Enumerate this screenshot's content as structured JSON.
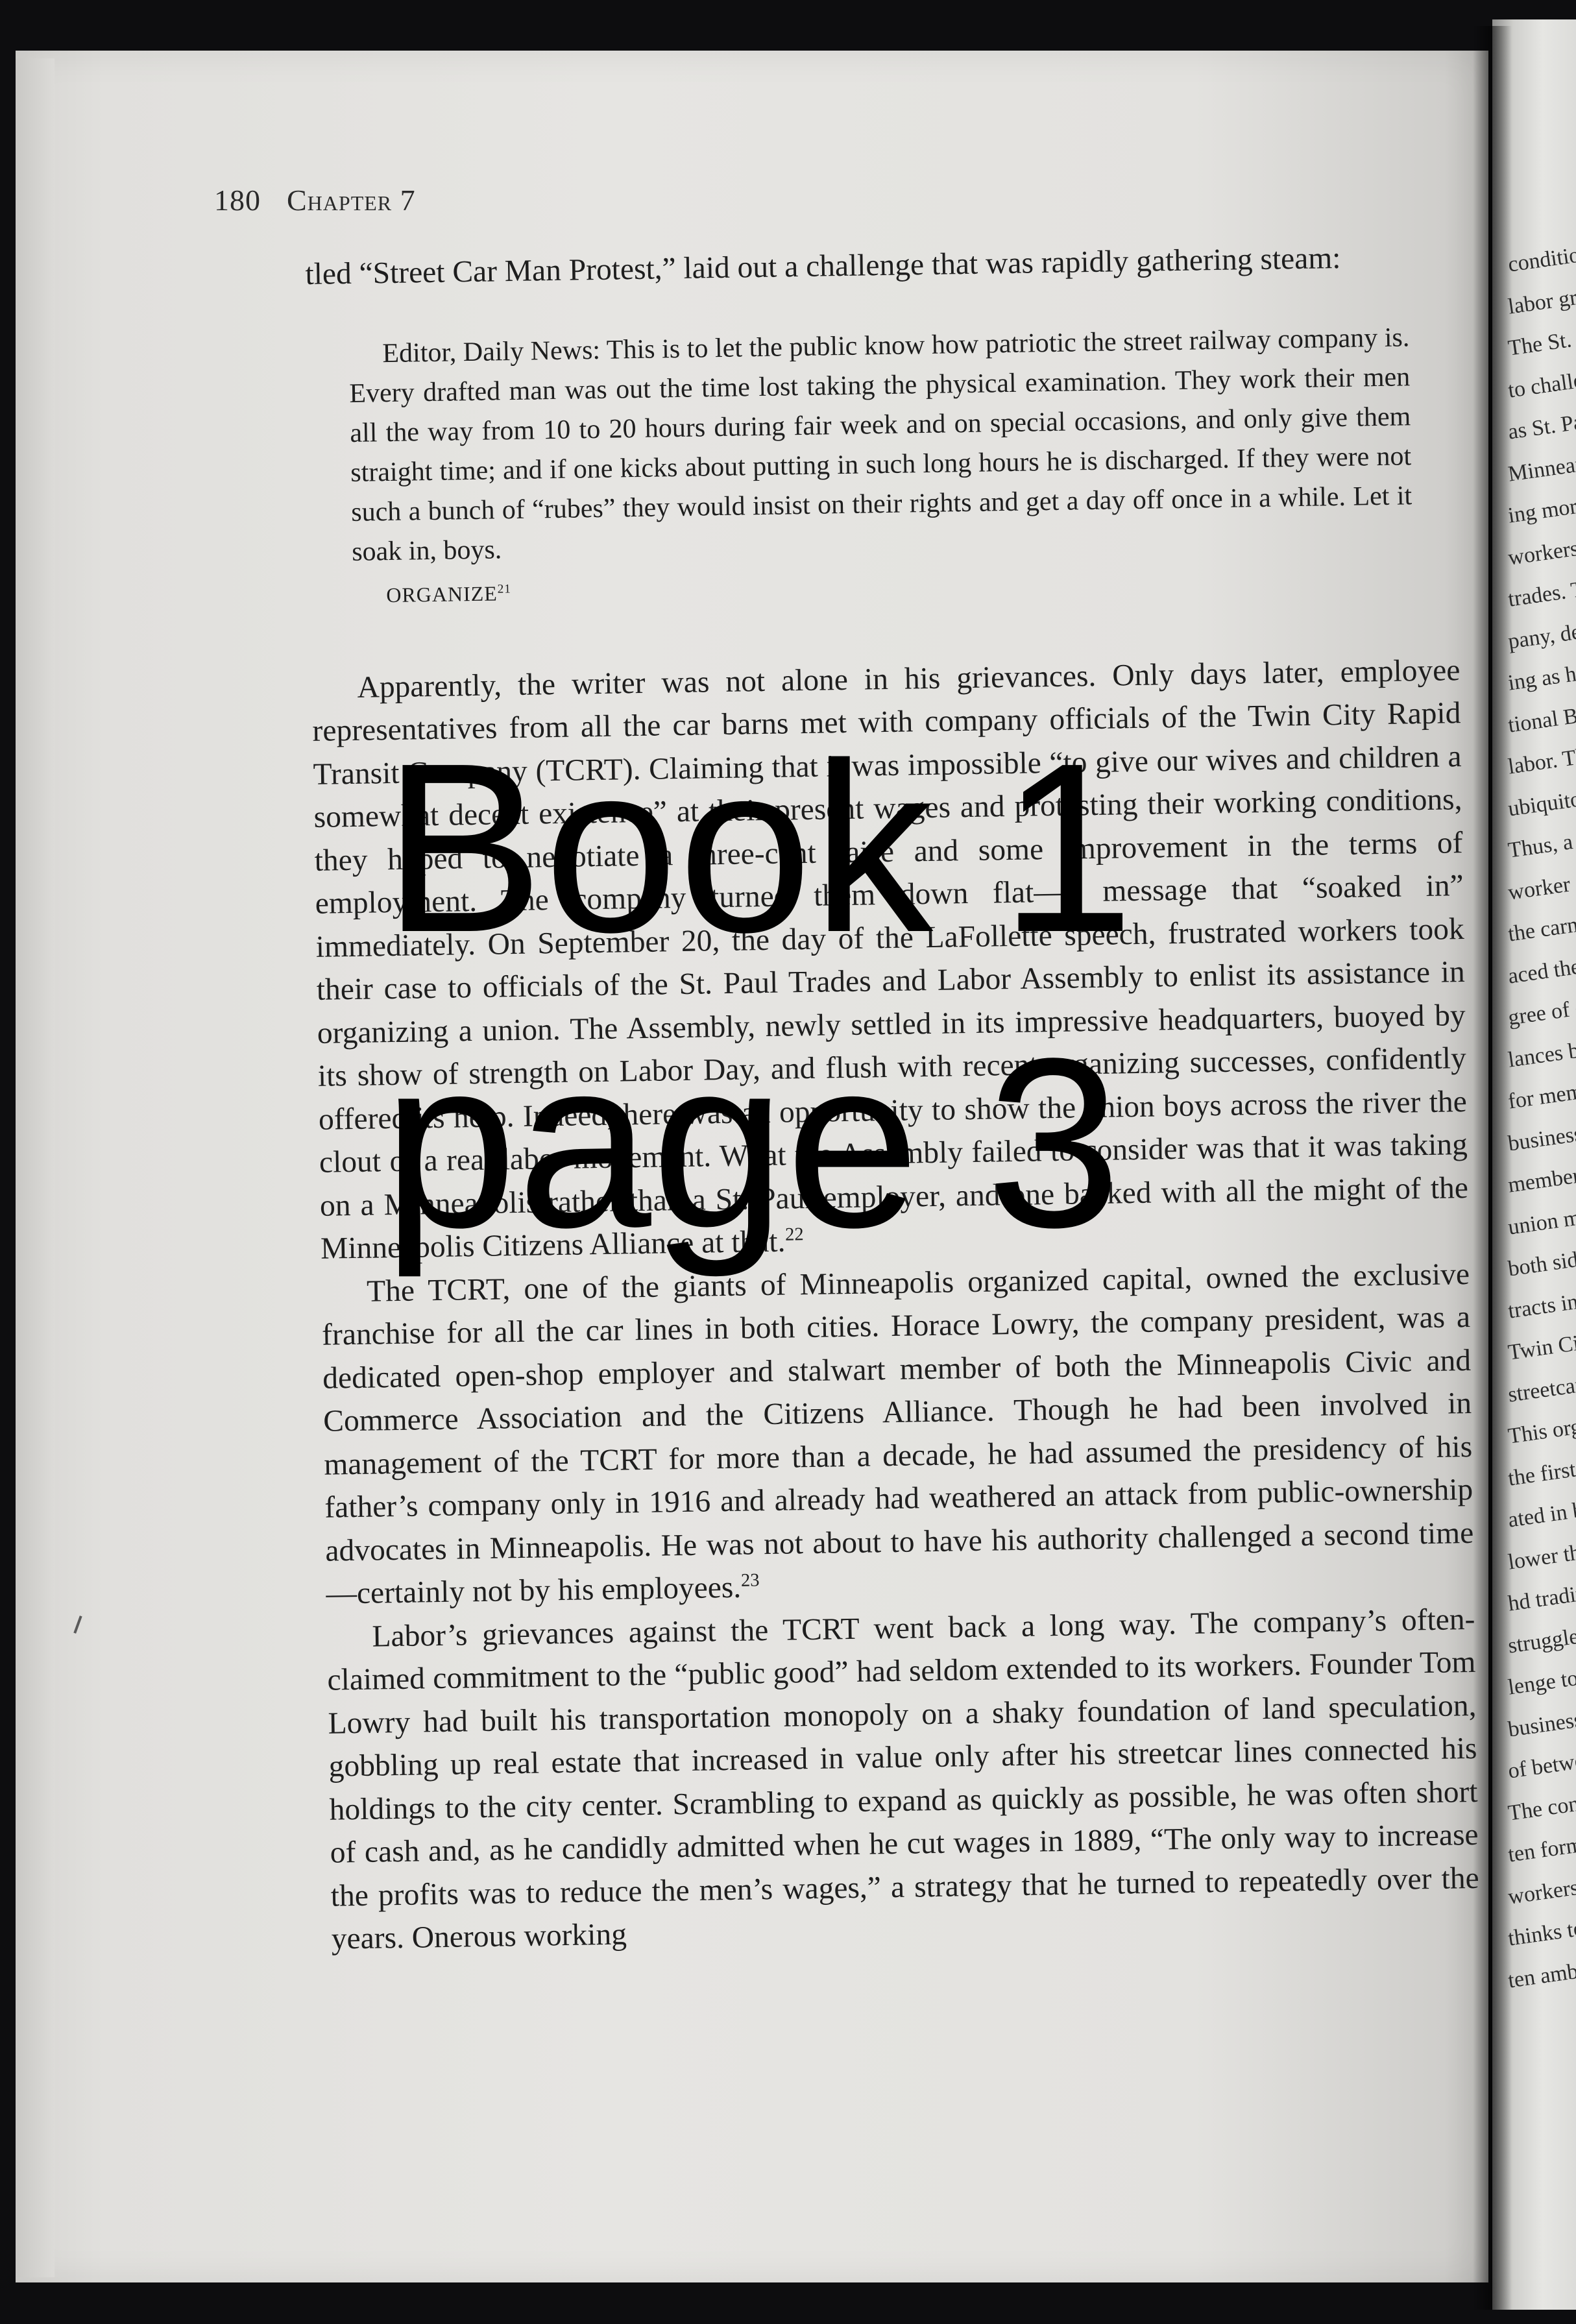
{
  "header": {
    "page_number": "180",
    "chapter": "Chapter 7"
  },
  "body": {
    "intro": "tled “Street Car Man Protest,” laid out a challenge that was rapidly gathering steam:",
    "extract": {
      "text": "Editor, Daily News: This is to let the public know how patriotic the street railway company is. Every drafted man was out the time lost taking the physical examination. They work their men all the way from 10 to 20 hours during fair week and on special occasions, and only give them straight time; and if one kicks about putting in such long hours he is discharged. If they were not such a bunch of “rubes” they would insist on their rights and get a day off once in a while. Let it soak in, boys.",
      "signature": "ORGANIZE",
      "note": "21"
    },
    "p1": {
      "text": "Apparently, the writer was not alone in his grievances. Only days later, employee representatives from all the car barns met with company officials of the Twin City Rapid Transit Company (TCRT). Claiming that it was impossible “to give our wives and children a somewhat decent existence” at their present wages and protesting their working conditions, they hoped to negotiate a three-cent raise and some improvement in the terms of employment. The company turned them down flat—a message that “soaked in” immediately. On September 20, the day of the LaFollette speech, frustrated workers took their case to officials of the St. Paul Trades and Labor Assembly to enlist its assistance in organizing a union. The Assembly, newly settled in its impressive headquarters, buoyed by its show of strength on Labor Day, and flush with recent organizing successes, confidently offered its help. Indeed, here was an opportunity to show the union boys across the river the clout of a real labor movement. What the Assembly failed to consider was that it was taking on a Minneapolis rather than a St. Paul employer, and one backed with all the might of the Minneapolis Citizens Alliance at that.",
      "note": "22"
    },
    "p2": {
      "text": "The TCRT, one of the giants of Minneapolis organized capital, owned the exclusive franchise for all the car lines in both cities. Horace Lowry, the company president, was a dedicated open-shop employer and stalwart member of both the Minneapolis Civic and Commerce Association and the Citizens Alliance. Though he had been involved in management of the TCRT for more than a decade, he had assumed the presidency of his father’s company only in 1916 and already had weathered an attack from public-ownership advocates in Minneapolis. He was not about to have his authority challenged a second time—certainly not by his employees.",
      "note": "23"
    },
    "p3": {
      "text": "Labor’s grievances against the TCRT went back a long way. The company’s often-claimed commitment to the “public good” had seldom extended to its workers. Founder Tom Lowry had built his transportation monopoly on a shaky foundation of land speculation, gobbling up real estate that increased in value only after his streetcar lines connected his holdings to the city center. Scrambling to expand as quickly as possible, he was often short of cash and, as he candidly admitted when he cut wages in 1889, “The only way to increase the profits was to reduce the men’s wages,” a strategy that he turned to repeatedly over the years. Onerous working"
    }
  },
  "overlay": {
    "line1": "Book 1",
    "line2": "page 3"
  },
  "facing_page": [
    "conditions o",
    "labor grievan",
    "The St. P",
    "to challenge",
    "as St. Paul's",
    "Minneapolis",
    "ing more th",
    "workers. Th",
    "trades. Two",
    "pany, devel",
    "ing as his o",
    "tional Buil",
    "labor. The l",
    "ubiquitous",
    "Thus, a",
    "worker soli",
    "the carmen",
    "aced them.",
    "gree of coo",
    "lances betw",
    "for membe",
    "business. A",
    "membersh",
    "union mem",
    "both sides",
    "tracts in M",
    "Twin Citie",
    "streetcar c",
    "This org",
    "the first tin",
    "ated in b",
    "lower tha",
    "hd traditi",
    "struggle. T",
    "lenge to sh",
    "business c",
    "of betwee",
    "The con",
    "ten forma",
    "workers o",
    "thinks to c",
    "ten ambi"
  ]
}
